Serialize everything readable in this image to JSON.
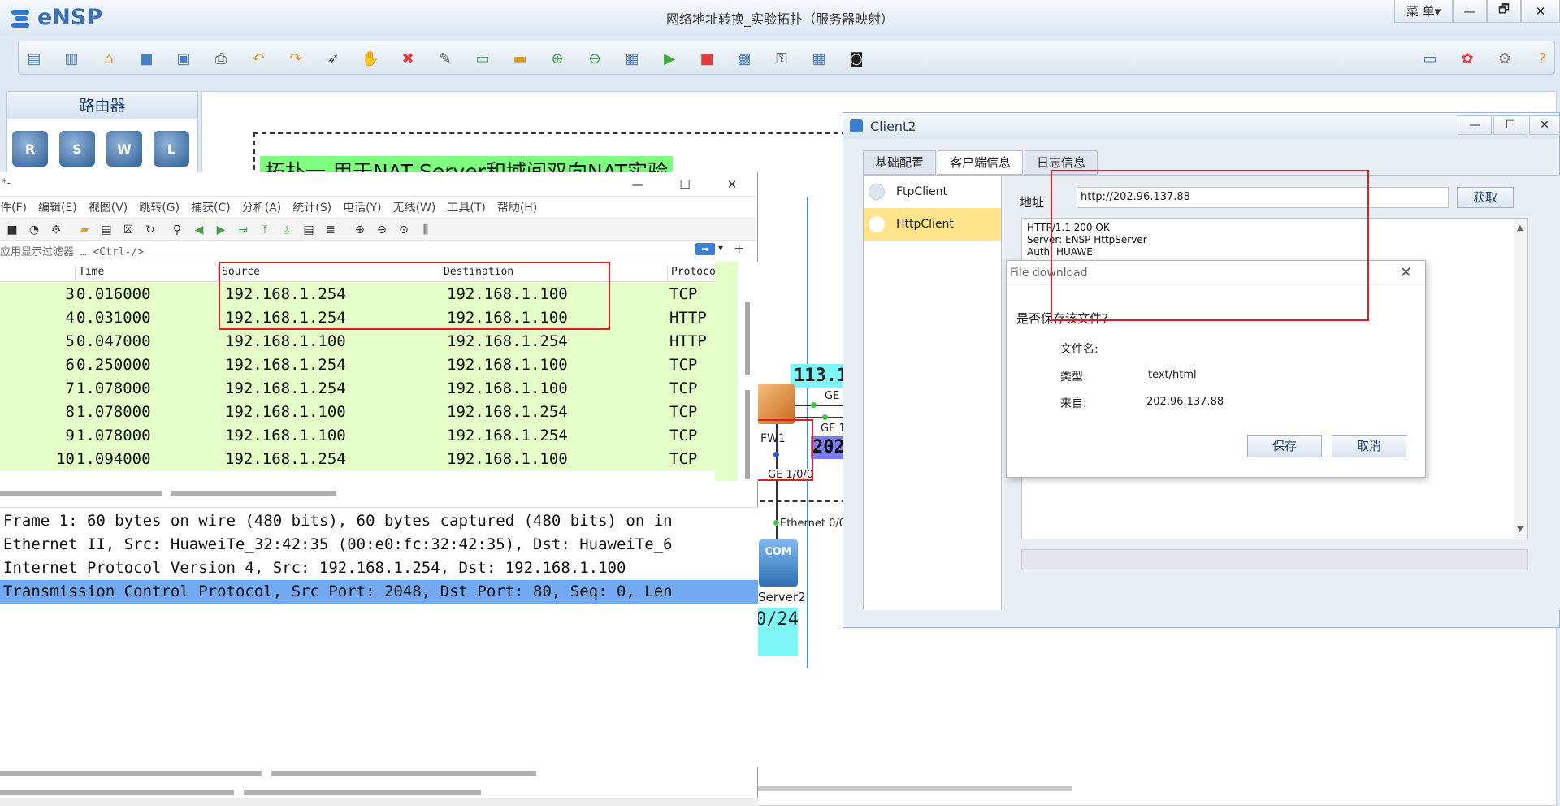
{
  "ensp": {
    "app_name": "eNSP",
    "window_title": "网络地址转换_实验拓扑（服务器映射）",
    "menu_button": "菜 单▾",
    "minimize": "—",
    "restore": "🗗",
    "close": "✕",
    "toolbar_icons": [
      "new-topo-icon",
      "new-example-icon",
      "open-icon",
      "save-icon",
      "save-as-icon",
      "print-icon",
      "undo-icon",
      "redo-icon",
      "select-icon",
      "hand-icon",
      "delete-icon",
      "delete-link-icon",
      "text-icon",
      "palette-icon",
      "zoom-in-icon",
      "zoom-out-icon",
      "fit-icon",
      "start-icon",
      "stop-icon",
      "capture-icon",
      "topology-icon",
      "grid-icon",
      "terminal-icon"
    ],
    "right_icons": [
      "chat-icon",
      "huawei-icon",
      "settings-icon",
      "help-icon"
    ],
    "library_title": "路由器",
    "library_devices": [
      "R",
      "S",
      "W",
      "L"
    ]
  },
  "topology": {
    "title_text": "拓扑一 用于NAT Server和域间双向NAT实验",
    "ip_public_fragment": "113.1",
    "ip_blue_fragment": "202",
    "ip_cyan_fragment": "0/24",
    "fw_label": "FW1",
    "ge_a": "GE",
    "ge_b": "GE 1",
    "ge_100": "GE 1/0/0",
    "eth_label": "Ethernet 0/0/",
    "server_label": "Server2",
    "server_icon_text": "COM"
  },
  "wireshark": {
    "title": "*-",
    "menu": [
      "件(F)",
      "编辑(E)",
      "视图(V)",
      "跳转(G)",
      "捕获(C)",
      "分析(A)",
      "统计(S)",
      "电话(Y)",
      "无线(W)",
      "工具(T)",
      "帮助(H)"
    ],
    "filter_placeholder": "应用显示过滤器 … <Ctrl-/>",
    "filter_apply": "➡",
    "columns": {
      "no": "",
      "time": "Time",
      "source": "Source",
      "destination": "Destination",
      "protocol": "Protoco"
    },
    "packets": [
      {
        "no": "3",
        "time": "0.016000",
        "source": "192.168.1.254",
        "destination": "192.168.1.100",
        "protocol": "TCP"
      },
      {
        "no": "4",
        "time": "0.031000",
        "source": "192.168.1.254",
        "destination": "192.168.1.100",
        "protocol": "HTTP"
      },
      {
        "no": "5",
        "time": "0.047000",
        "source": "192.168.1.100",
        "destination": "192.168.1.254",
        "protocol": "HTTP"
      },
      {
        "no": "6",
        "time": "0.250000",
        "source": "192.168.1.254",
        "destination": "192.168.1.100",
        "protocol": "TCP"
      },
      {
        "no": "7",
        "time": "1.078000",
        "source": "192.168.1.254",
        "destination": "192.168.1.100",
        "protocol": "TCP"
      },
      {
        "no": "8",
        "time": "1.078000",
        "source": "192.168.1.100",
        "destination": "192.168.1.254",
        "protocol": "TCP"
      },
      {
        "no": "9",
        "time": "1.078000",
        "source": "192.168.1.100",
        "destination": "192.168.1.254",
        "protocol": "TCP"
      },
      {
        "no": "10",
        "time": "1.094000",
        "source": "192.168.1.254",
        "destination": "192.168.1.100",
        "protocol": "TCP"
      }
    ],
    "details": [
      "Frame 1: 60 bytes on wire (480 bits), 60 bytes captured (480 bits) on in",
      "Ethernet II, Src: HuaweiTe_32:42:35 (00:e0:fc:32:42:35), Dst: HuaweiTe_6",
      "Internet Protocol Version 4, Src: 192.168.1.254, Dst: 192.168.1.100",
      "Transmission Control Protocol, Src Port: 2048, Dst Port: 80, Seq: 0, Len"
    ],
    "selected_detail_index": 3,
    "highlight_color": "#73a9f0",
    "row_color": "#e4ffc7"
  },
  "client": {
    "title": "Client2",
    "tabs": [
      "基础配置",
      "客户端信息",
      "日志信息"
    ],
    "active_tab": 1,
    "side_items": [
      "FtpClient",
      "HttpClient"
    ],
    "active_side": 1,
    "address_label": "地址",
    "address_value": "http://202.96.137.88",
    "fetch_button": "获取",
    "response_lines": [
      "HTTP/1.1 200 OK",
      "Server: ENSP HttpServer",
      "Auth: HUAWEI"
    ]
  },
  "dialog": {
    "title": "File download",
    "question": "是否保存该文件?",
    "filename_label": "文件名:",
    "filename_value": "",
    "type_label": "类型:",
    "type_value": "text/html",
    "from_label": "来自:",
    "from_value": "202.96.137.88",
    "save_button": "保存",
    "cancel_button": "取消"
  }
}
